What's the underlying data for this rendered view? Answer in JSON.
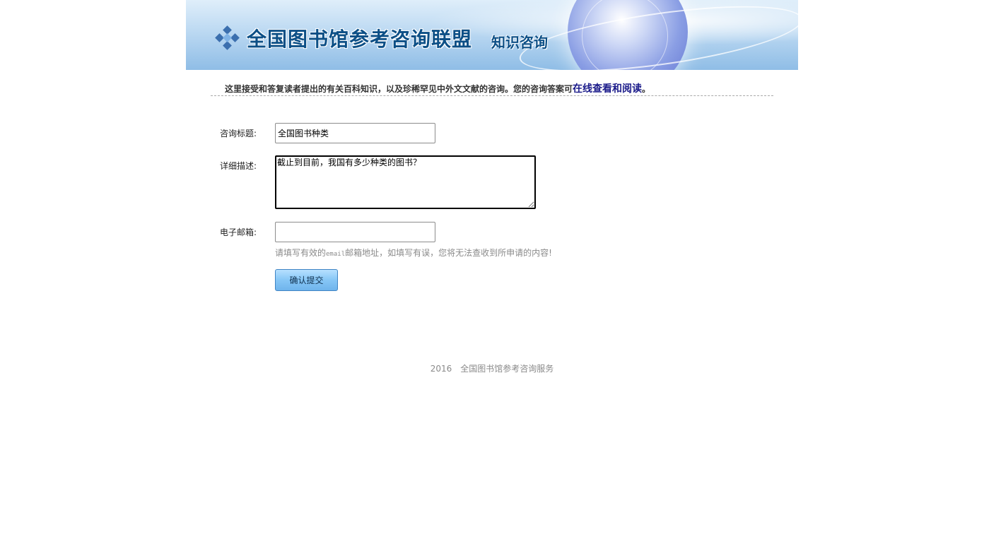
{
  "banner": {
    "title": "全国图书馆参考咨询联盟",
    "subtitle": "知识咨询"
  },
  "intro": {
    "text": "这里接受和答复读者提出的有关百科知识，以及珍稀罕见中外文文献的咨询。您的咨询答案可",
    "link": "在线查看和阅读",
    "end": "。"
  },
  "form": {
    "title_label": "咨询标题:",
    "title_value": "全国图书种类",
    "desc_label": "详细描述:",
    "desc_value": "截止到目前，我国有多少种类的图书？",
    "email_label": "电子邮箱:",
    "email_value": "",
    "hint_pre": "请填写有效的",
    "hint_mono": "email",
    "hint_post": "邮箱地址，如填写有误，您将无法查收到所申请的内容!",
    "submit_label": "确认提交"
  },
  "footer": {
    "year": "2016",
    "text": "全国图书馆参考咨询服务"
  }
}
